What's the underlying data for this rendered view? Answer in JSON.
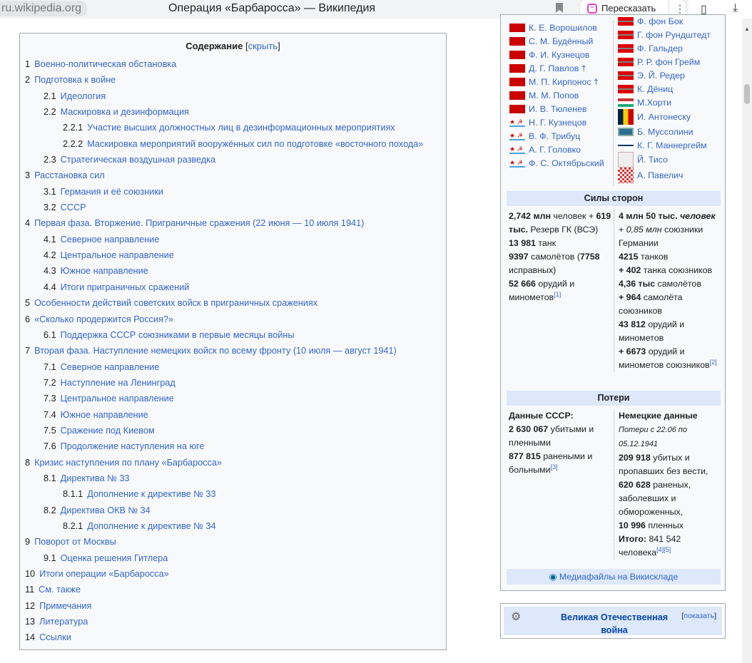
{
  "browser": {
    "url": "ru.wikipedia.org",
    "title": "Операция «Барбаросса» — Википедия",
    "retell_label": "Пересказать"
  },
  "toc": {
    "title": "Содержание",
    "toggle": "скрыть",
    "items": [
      {
        "n": "1",
        "t": "Военно-политическая обстановка",
        "l": 1
      },
      {
        "n": "2",
        "t": "Подготовка к войне",
        "l": 1
      },
      {
        "n": "2.1",
        "t": "Идеология",
        "l": 2
      },
      {
        "n": "2.2",
        "t": "Маскировка и дезинформация",
        "l": 2
      },
      {
        "n": "2.2.1",
        "t": "Участие высших должностных лиц в дезинформационных мероприятиях",
        "l": 3
      },
      {
        "n": "2.2.2",
        "t": "Маскировка мероприятий вооружённых сил по подготовке «восточного похода»",
        "l": 3
      },
      {
        "n": "2.3",
        "t": "Стратегическая воздушная разведка",
        "l": 2
      },
      {
        "n": "3",
        "t": "Расстановка сил",
        "l": 1
      },
      {
        "n": "3.1",
        "t": "Германия и её союзники",
        "l": 2
      },
      {
        "n": "3.2",
        "t": "СССР",
        "l": 2
      },
      {
        "n": "4",
        "t": "Первая фаза. Вторжение. Приграничные сражения (22 июня — 10 июля 1941)",
        "l": 1
      },
      {
        "n": "4.1",
        "t": "Северное направление",
        "l": 2
      },
      {
        "n": "4.2",
        "t": "Центральное направление",
        "l": 2
      },
      {
        "n": "4.3",
        "t": "Южное направление",
        "l": 2
      },
      {
        "n": "4.4",
        "t": "Итоги приграничных сражений",
        "l": 2
      },
      {
        "n": "5",
        "t": "Особенности действий советских войск в приграничных сражениях",
        "l": 1
      },
      {
        "n": "6",
        "t": "«Сколько продержится Россия?»",
        "l": 1
      },
      {
        "n": "6.1",
        "t": "Поддержка СССР союзниками в первые месяцы войны",
        "l": 2
      },
      {
        "n": "7",
        "t": "Вторая фаза. Наступление немецких войск по всему фронту (10 июля — август 1941)",
        "l": 1
      },
      {
        "n": "7.1",
        "t": "Северное направление",
        "l": 2
      },
      {
        "n": "7.2",
        "t": "Наступление на Ленинград",
        "l": 2
      },
      {
        "n": "7.3",
        "t": "Центральное направление",
        "l": 2
      },
      {
        "n": "7.4",
        "t": "Южное направление",
        "l": 2
      },
      {
        "n": "7.5",
        "t": "Сражение под Киевом",
        "l": 2
      },
      {
        "n": "7.6",
        "t": "Продолжение наступления на юге",
        "l": 2
      },
      {
        "n": "8",
        "t": "Кризис наступления по плану «Барбаросса»",
        "l": 1
      },
      {
        "n": "8.1",
        "t": "Директива № 33",
        "l": 2
      },
      {
        "n": "8.1.1",
        "t": "Дополнение к директиве № 33",
        "l": 3
      },
      {
        "n": "8.2",
        "t": "Директива ОКВ № 34",
        "l": 2
      },
      {
        "n": "8.2.1",
        "t": "Дополнение к директиве № 34",
        "l": 3
      },
      {
        "n": "9",
        "t": "Поворот от Москвы",
        "l": 1
      },
      {
        "n": "9.1",
        "t": "Оценка решения Гитлера",
        "l": 2
      },
      {
        "n": "10",
        "t": "Итоги операции «Барбаросса»",
        "l": 1
      },
      {
        "n": "11",
        "t": "См. также",
        "l": 1
      },
      {
        "n": "12",
        "t": "Примечания",
        "l": 1
      },
      {
        "n": "13",
        "t": "Литература",
        "l": 1
      },
      {
        "n": "14",
        "t": "Ссылки",
        "l": 1
      }
    ]
  },
  "infobox": {
    "ussr_commanders": [
      {
        "name": "К. Е. Ворошилов",
        "flag": "su"
      },
      {
        "name": "С. М. Будённый",
        "flag": "su"
      },
      {
        "name": "Ф. И. Кузнецов",
        "flag": "su"
      },
      {
        "name": "Д. Г. Павлов †",
        "flag": "su"
      },
      {
        "name": "М. П. Кирпонос †",
        "flag": "su"
      },
      {
        "name": "М. М. Попов",
        "flag": "su"
      },
      {
        "name": "И. В. Тюленев",
        "flag": "su"
      },
      {
        "name": "Н. Г. Кузнецов",
        "flag": "navy"
      },
      {
        "name": "В. Ф. Трибуц",
        "flag": "navy"
      },
      {
        "name": "А. Г. Головко",
        "flag": "navy"
      },
      {
        "name": "Ф. С. Октябрьский",
        "flag": "navy"
      }
    ],
    "axis_commanders": [
      {
        "name": "Ф. фон Бок",
        "flag": "de"
      },
      {
        "name": "Г. фон Рундштедт",
        "flag": "de"
      },
      {
        "name": "Ф. Гальдер",
        "flag": "de"
      },
      {
        "name": "Р. Р. фон Грейм",
        "flag": "de"
      },
      {
        "name": "Э. Й. Редер",
        "flag": "de"
      },
      {
        "name": "К. Дёниц",
        "flag": "de"
      },
      {
        "name": "М.Хорти",
        "flag": "hu"
      },
      {
        "name": "И. Антонеску",
        "flag": "ro"
      },
      {
        "name": "Б. Муссолини",
        "flag": "it"
      },
      {
        "name": "К. Г. Маннергейм",
        "flag": "fi"
      },
      {
        "name": "Й. Тисо",
        "flag": "sk"
      },
      {
        "name": "А. Павелич",
        "flag": "hr"
      }
    ],
    "forces_header": "Силы сторон",
    "ussr_forces": [
      [
        "b",
        "2,742 млн"
      ],
      [
        "t",
        " человек + "
      ],
      [
        "b",
        "619 тыс."
      ],
      [
        "t",
        " Резерв ГК (ВСЭ)"
      ],
      [
        "br",
        ""
      ],
      [
        "b",
        "13 981"
      ],
      [
        "t",
        " танк"
      ],
      [
        "br",
        ""
      ],
      [
        "b",
        "9397"
      ],
      [
        "t",
        " самолётов ("
      ],
      [
        "b",
        "7758"
      ],
      [
        "t",
        " исправных)"
      ],
      [
        "br",
        ""
      ],
      [
        "b",
        "52 666"
      ],
      [
        "t",
        " орудий и минометов"
      ],
      [
        "sup",
        "[1]"
      ]
    ],
    "axis_forces": [
      [
        "b",
        "4 млн 50 тыс. "
      ],
      [
        "bi",
        "человек"
      ],
      [
        "br",
        ""
      ],
      [
        "t",
        "+ "
      ],
      [
        "i",
        "0,85 млн"
      ],
      [
        "t",
        " союзники Германии"
      ],
      [
        "br",
        ""
      ],
      [
        "b",
        "4215"
      ],
      [
        "t",
        " танков"
      ],
      [
        "br",
        ""
      ],
      [
        "b",
        "+ 402"
      ],
      [
        "t",
        " танка союзников"
      ],
      [
        "br",
        ""
      ],
      [
        "b",
        "4,36 тыс"
      ],
      [
        "t",
        " самолётов"
      ],
      [
        "br",
        ""
      ],
      [
        "b",
        "+ 964"
      ],
      [
        "t",
        " самолёта союзников"
      ],
      [
        "br",
        ""
      ],
      [
        "b",
        "43 812"
      ],
      [
        "t",
        " орудий и минометов"
      ],
      [
        "br",
        ""
      ],
      [
        "b",
        "+ 6673"
      ],
      [
        "t",
        " орудий и минометов союзников"
      ],
      [
        "sup",
        "[2]"
      ]
    ],
    "losses_header": "Потери",
    "ussr_losses": [
      [
        "b",
        "Данные СССР:"
      ],
      [
        "br",
        ""
      ],
      [
        "b",
        "2 630 067"
      ],
      [
        "t",
        " убитыми и пленными"
      ],
      [
        "br",
        ""
      ],
      [
        "b",
        "877 815"
      ],
      [
        "t",
        " ранеными и больными"
      ],
      [
        "sup",
        "[3]"
      ]
    ],
    "axis_losses": [
      [
        "b",
        "Немецкие данные"
      ],
      [
        "br",
        ""
      ],
      [
        "si",
        "Потери с 22.06 по 05.12.1941"
      ],
      [
        "br",
        ""
      ],
      [
        "b",
        "209 918"
      ],
      [
        "t",
        " убитых и пропавших без вести,"
      ],
      [
        "br",
        ""
      ],
      [
        "b",
        "620 628"
      ],
      [
        "t",
        " раненых, заболевших и обмороженных,"
      ],
      [
        "br",
        ""
      ],
      [
        "b",
        "10 996"
      ],
      [
        "t",
        " пленных"
      ],
      [
        "br",
        ""
      ],
      [
        "b",
        "Итого:"
      ],
      [
        "t",
        " 841 542 человека"
      ],
      [
        "sup",
        "[4]"
      ],
      [
        "sup",
        "[5]"
      ]
    ],
    "commons_link": "Медиафайлы на Викискладе"
  },
  "navbox": {
    "title": "Великая Отечественная война",
    "toggle": "показать"
  }
}
